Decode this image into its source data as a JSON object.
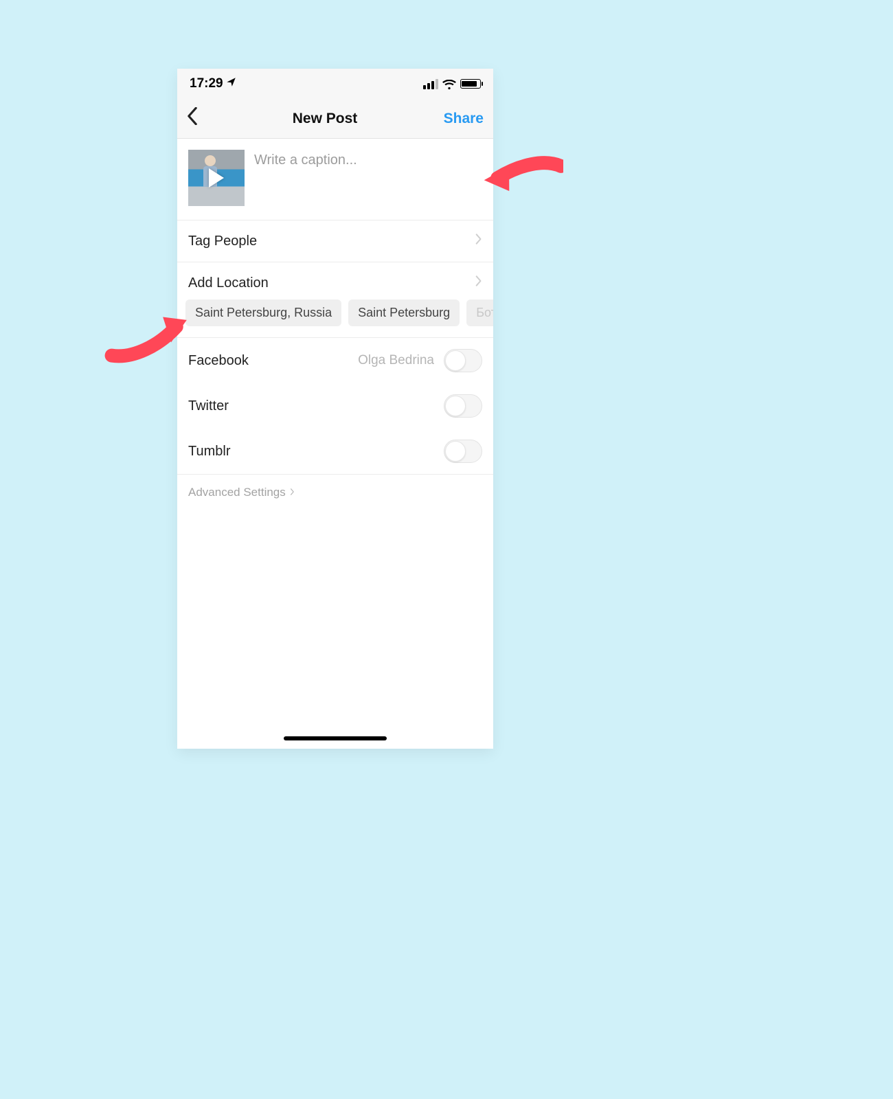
{
  "status": {
    "time": "17:29"
  },
  "nav": {
    "title": "New Post",
    "share_label": "Share"
  },
  "caption": {
    "placeholder": "Write a caption..."
  },
  "rows": {
    "tag_people": "Tag People",
    "add_location": "Add Location"
  },
  "location_suggestions": [
    "Saint Petersburg, Russia",
    "Saint Petersburg",
    "Бота"
  ],
  "share_targets": {
    "facebook": {
      "label": "Facebook",
      "account": "Olga Bedrina"
    },
    "twitter": {
      "label": "Twitter"
    },
    "tumblr": {
      "label": "Tumblr"
    }
  },
  "advanced_label": "Advanced Settings"
}
